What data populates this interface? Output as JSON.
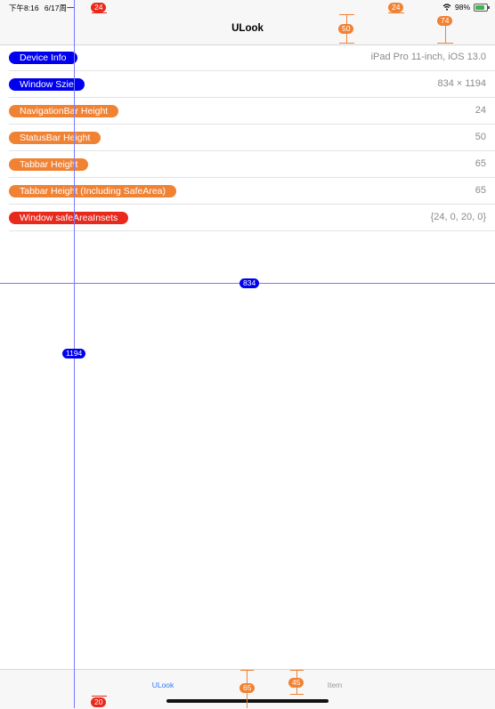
{
  "colors": {
    "blue": "#0000ee",
    "orange": "#f08234",
    "red": "#e8291c",
    "tab_active": "#3478f6",
    "tab_inactive": "#999999"
  },
  "status_bar": {
    "time": "下午8:16",
    "date": "6/17周一",
    "battery": "98%",
    "wifi_icon": "wifi-icon",
    "battery_icon": "battery-charging-icon"
  },
  "nav_bar": {
    "title": "ULook"
  },
  "rows": [
    {
      "label": "Device Info",
      "value": "iPad Pro 11-inch, iOS 13.0",
      "color": "#0000ee"
    },
    {
      "label": "Window Szie",
      "value": "834 × 1194",
      "color": "#0000ee"
    },
    {
      "label": "NavigationBar Height",
      "value": "24",
      "color": "#f08234"
    },
    {
      "label": "StatusBar Height",
      "value": "50",
      "color": "#f08234"
    },
    {
      "label": "Tabbar Height",
      "value": "65",
      "color": "#f08234"
    },
    {
      "label": "Tabbar Height (Including SafeArea)",
      "value": "65",
      "color": "#f08234"
    },
    {
      "label": "Window safeAreaInsets",
      "value": "{24, 0, 20, 0}",
      "color": "#e8291c"
    }
  ],
  "overlay": {
    "safe_top": "24",
    "nav_height": "24",
    "status_height": "50",
    "combined_top": "74",
    "width": "834",
    "height": "1194",
    "tabbar_height": "65",
    "tabbar_inner": "45",
    "safe_bottom": "20"
  },
  "tab_bar": {
    "tabs": [
      {
        "label": "ULook",
        "active": true
      },
      {
        "label": "Item",
        "active": false
      }
    ]
  }
}
